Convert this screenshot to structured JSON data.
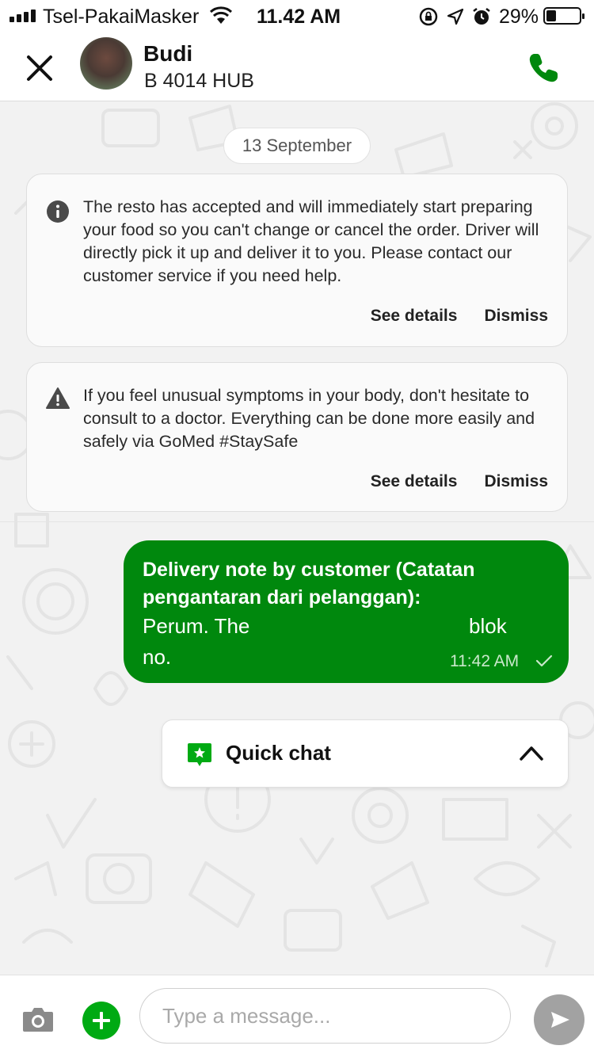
{
  "status_bar": {
    "carrier": "Tsel-PakaiMasker",
    "time": "11.42 AM",
    "battery_pct": "29%",
    "battery_level": 0.29,
    "icons": [
      "signal-icon",
      "wifi-icon",
      "rotation-lock-icon",
      "location-icon",
      "alarm-icon",
      "battery-icon"
    ]
  },
  "header": {
    "name": "Budi",
    "subtitle": "B 4014 HUB",
    "close_icon": "close-icon",
    "call_icon": "phone-icon",
    "accent": "#00880d"
  },
  "chat": {
    "date": "13 September",
    "cards": [
      {
        "icon": "info-icon",
        "text": "The resto has accepted and will immediately start preparing your food so you can't change or cancel the order. Driver will directly pick it up and deliver it to you. Please contact our customer service if you need help.",
        "details": "See details",
        "dismiss": "Dismiss"
      },
      {
        "icon": "warning-icon",
        "text": "If you feel unusual symptoms in your body, don't hesitate to consult to a doctor. Everything can be done more easily and safely via GoMed #StaySafe",
        "details": "See details",
        "dismiss": "Dismiss"
      }
    ],
    "message": {
      "title": "Delivery note by customer (Catatan pengantaran dari pelanggan):",
      "body_start": "Perum. The",
      "body_mid": "blok",
      "body_end": "no.",
      "time": "11:42 AM",
      "status_icon": "check-icon",
      "bubble_color": "#00880d"
    },
    "quick_chat": {
      "label": "Quick chat",
      "icon": "quick-chat-star-icon",
      "chevron": "chevron-up-icon"
    }
  },
  "input_bar": {
    "placeholder": "Type a message...",
    "camera_icon": "camera-icon",
    "add_icon": "plus-icon",
    "send_icon": "send-icon",
    "add_color": "#00aa13",
    "send_color": "#a2a2a2"
  }
}
